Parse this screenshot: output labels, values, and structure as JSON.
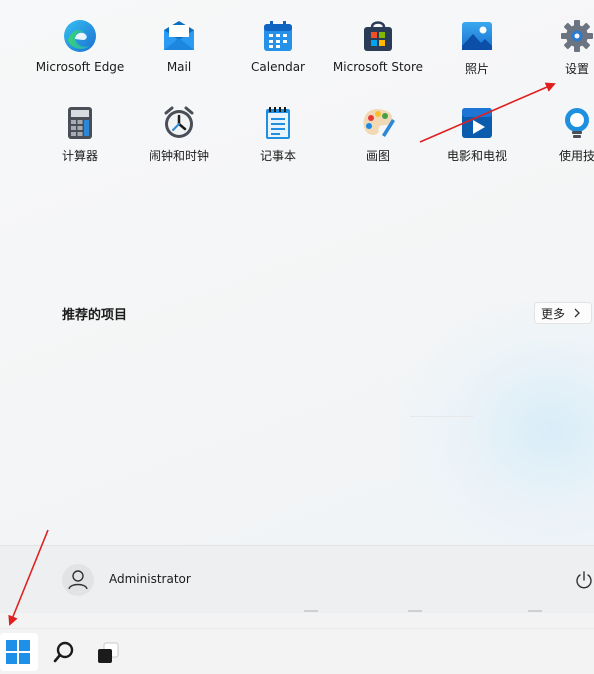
{
  "pinned_apps": [
    {
      "label": "Microsoft Edge",
      "icon": "edge-icon"
    },
    {
      "label": "Mail",
      "icon": "mail-icon"
    },
    {
      "label": "Calendar",
      "icon": "calendar-icon"
    },
    {
      "label": "Microsoft Store",
      "icon": "store-icon"
    },
    {
      "label": "照片",
      "icon": "photos-icon"
    },
    {
      "label": "设置",
      "icon": "gear-icon"
    },
    {
      "label": "计算器",
      "icon": "calculator-icon"
    },
    {
      "label": "闹钟和时钟",
      "icon": "clock-icon"
    },
    {
      "label": "记事本",
      "icon": "notepad-icon"
    },
    {
      "label": "画图",
      "icon": "paint-icon"
    },
    {
      "label": "电影和电视",
      "icon": "movies-icon"
    },
    {
      "label": "使用技",
      "icon": "tips-icon"
    }
  ],
  "recommended": {
    "title": "推荐的项目",
    "more_label": "更多"
  },
  "footer": {
    "user_name": "Administrator"
  },
  "colors": {
    "accent": "#0078d4",
    "annotation_arrow": "#e02020"
  }
}
